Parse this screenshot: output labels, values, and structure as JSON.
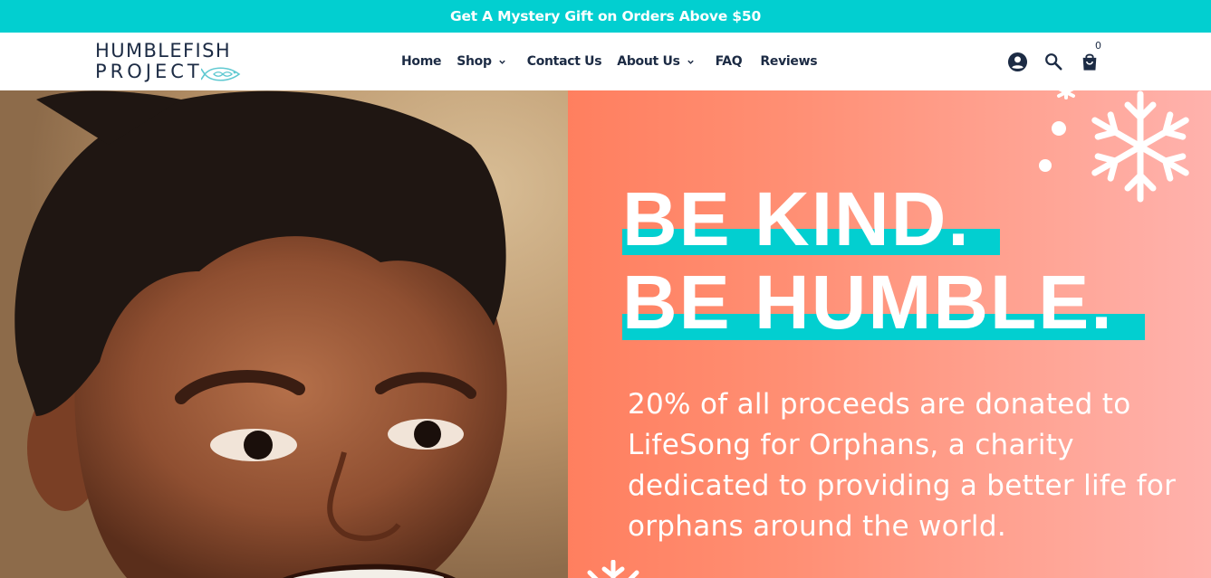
{
  "promo_bar": {
    "text": "Get A Mystery Gift on Orders Above $50"
  },
  "logo": {
    "line1": "HUMBLEFISH",
    "line2": "PROJECT"
  },
  "nav": {
    "items": [
      {
        "label": "Home",
        "has_dropdown": false
      },
      {
        "label": "Shop",
        "has_dropdown": true
      },
      {
        "label": "Contact Us",
        "has_dropdown": false
      },
      {
        "label": "About Us",
        "has_dropdown": true
      },
      {
        "label": "FAQ",
        "has_dropdown": false
      },
      {
        "label": "Reviews",
        "has_dropdown": false
      }
    ]
  },
  "header_icons": {
    "account": "account-circle-icon",
    "search": "search-icon",
    "cart": "shopping-bag-icon",
    "cart_count": "0"
  },
  "hero": {
    "headline_line1": "BE KIND.",
    "headline_line2": "BE HUMBLE.",
    "body": "20% of all proceeds are donated to LifeSong for Orphans, a charity dedicated to providing a better life for orphans around the world.",
    "photo_alt": "smiling-boy-photo"
  },
  "colors": {
    "promo_bar_bg": "#02cfd0",
    "brand_text": "#1c2b44",
    "accent_teal": "#02cfd0",
    "panel_coral": "#ff7f5f",
    "panel_pink": "#ffb2ad"
  }
}
